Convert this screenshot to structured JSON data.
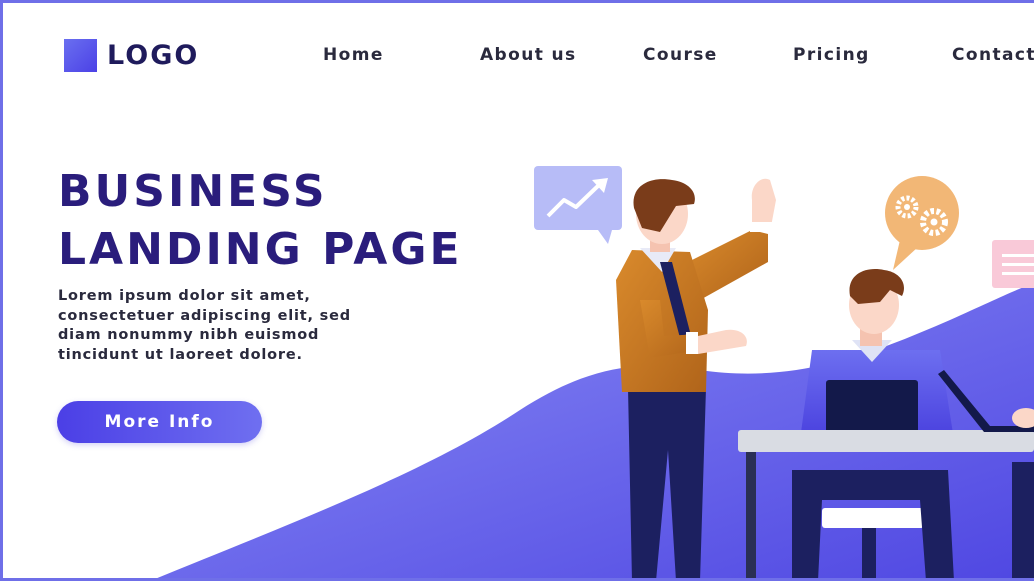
{
  "header": {
    "logo_text": "LOGO",
    "nav": [
      {
        "label": "Home"
      },
      {
        "label": "About us"
      },
      {
        "label": "Course"
      },
      {
        "label": "Pricing"
      },
      {
        "label": "Contact"
      }
    ]
  },
  "hero": {
    "title_line1": "BUSINESS",
    "title_line2": "LANDING PAGE",
    "desc_lines": [
      "Lorem ipsum dolor sit amet,",
      "consectetuer adipiscing elit, sed",
      "diam nonummy nibh euismod",
      "tincidunt ut laoreet dolore."
    ],
    "cta_label": "More Info"
  },
  "illustration": {
    "icons": [
      "growth-chart-icon",
      "gears-icon",
      "document-icon"
    ]
  },
  "colors": {
    "accent": "#4b3fe6",
    "accent_light": "#7a79f2",
    "title": "#2a1d7c",
    "text": "#2a2a3d",
    "jacket": "#c97a22",
    "pants": "#1c2060",
    "skin": "#fbd7c8",
    "hair": "#7a3c1a",
    "gear_bubble": "#f2b776"
  }
}
